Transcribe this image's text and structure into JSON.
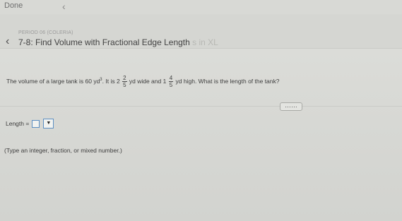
{
  "topbar": {
    "done_label": "Done",
    "back_icon": "chevron-left-icon"
  },
  "header": {
    "period": "PERIOD 06 (COLERIA)",
    "title_main": "7-8: Find Volume with Fractional Edge Length",
    "title_faded": "s in XL",
    "back_icon": "chevron-left-icon"
  },
  "question": {
    "text_before": "The volume of a large tank is 60 yd",
    "exponent": "3",
    "text_mid1": ". It is 2",
    "width_frac_num": "2",
    "width_frac_den": "5",
    "text_mid2": " yd wide and 1",
    "height_frac_num": "4",
    "height_frac_den": "5",
    "text_after": " yd high. What is the length of the tank?"
  },
  "more_button": {
    "label": "……"
  },
  "answer": {
    "label": "Length =",
    "dropdown_arrow": "▼"
  },
  "hint": {
    "text": "(Type an integer, fraction, or mixed number.)"
  }
}
